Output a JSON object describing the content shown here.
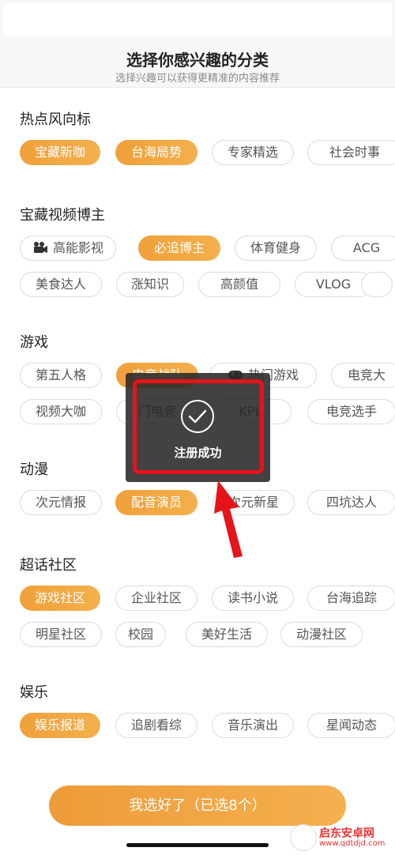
{
  "header": {
    "title": "选择你感兴趣的分类",
    "subtitle": "选择兴趣可以获得更精准的内容推荐"
  },
  "sections": [
    {
      "title": "热点风向标",
      "rows": [
        [
          {
            "label": "宝藏新咖",
            "selected": true
          },
          {
            "label": "台海局势",
            "selected": true
          },
          {
            "label": "专家精选",
            "selected": false
          },
          {
            "label": "社会时事",
            "selected": false
          }
        ]
      ]
    },
    {
      "title": "宝藏视频博主",
      "rows": [
        [
          {
            "label": "高能影视",
            "selected": false,
            "icon": "movie-camera-icon"
          },
          {
            "label": "必追博主",
            "selected": true
          },
          {
            "label": "体育健身",
            "selected": false
          },
          {
            "label": "ACG",
            "selected": false
          }
        ],
        [
          {
            "label": "美食达人",
            "selected": false
          },
          {
            "label": "涨知识",
            "selected": false
          },
          {
            "label": "高颜值",
            "selected": false
          },
          {
            "label": "VLOG",
            "selected": false
          },
          {
            "label": "",
            "selected": false
          }
        ]
      ]
    },
    {
      "title": "游戏",
      "rows": [
        [
          {
            "label": "第五人格",
            "selected": false
          },
          {
            "label": "电竞战队",
            "selected": true
          },
          {
            "label": "热门游戏",
            "selected": false,
            "icon": "game-controller-icon"
          },
          {
            "label": "电竞大",
            "selected": false
          }
        ],
        [
          {
            "label": "视频大咖",
            "selected": false
          },
          {
            "label": "门电竞",
            "selected": false
          },
          {
            "label": "KPL",
            "selected": false
          },
          {
            "label": "电竞选手",
            "selected": false
          }
        ]
      ]
    },
    {
      "title": "动漫",
      "rows": [
        [
          {
            "label": "次元情报",
            "selected": false
          },
          {
            "label": "配音演员",
            "selected": true
          },
          {
            "label": "次元新星",
            "selected": false
          },
          {
            "label": "四坑达人",
            "selected": false
          }
        ]
      ]
    },
    {
      "title": "超话社区",
      "rows": [
        [
          {
            "label": "游戏社区",
            "selected": true
          },
          {
            "label": "企业社区",
            "selected": false
          },
          {
            "label": "读书小说",
            "selected": false
          },
          {
            "label": "台海追踪",
            "selected": false
          }
        ],
        [
          {
            "label": "明星社区",
            "selected": false
          },
          {
            "label": "校园",
            "selected": false
          },
          {
            "label": "美好生活",
            "selected": false
          },
          {
            "label": "动漫社区",
            "selected": false
          }
        ]
      ]
    },
    {
      "title": "娱乐",
      "rows": [
        [
          {
            "label": "娱乐报道",
            "selected": true
          },
          {
            "label": "追剧看综",
            "selected": false
          },
          {
            "label": "音乐演出",
            "selected": false
          },
          {
            "label": "星闻动态",
            "selected": false
          }
        ]
      ]
    }
  ],
  "toast": {
    "message": "注册成功",
    "icon": "check-circle-icon"
  },
  "confirm_button": {
    "label": "我选好了（已选8个）"
  },
  "watermark": {
    "name": "启东安卓网",
    "url": "www.qdtdjd.com"
  },
  "colors": {
    "accent": "#f0a03a",
    "highlight": "#e5141a"
  }
}
